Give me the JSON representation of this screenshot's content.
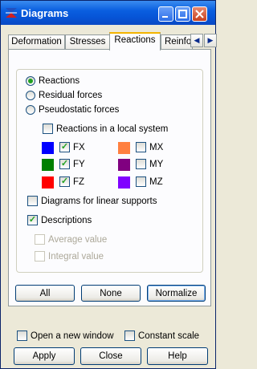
{
  "window": {
    "title": "Diagrams"
  },
  "tabs": [
    "Deformation",
    "Stresses",
    "Reactions",
    "Reinfo"
  ],
  "active_tab": "Reactions",
  "reaction_type": {
    "options": [
      "Reactions",
      "Residual forces",
      "Pseudostatic forces"
    ],
    "selected": "Reactions"
  },
  "local_system": {
    "label": "Reactions in a local system",
    "checked": false
  },
  "components": [
    {
      "label": "FX",
      "color": "#0000ff",
      "checked": true
    },
    {
      "label": "FY",
      "color": "#008000",
      "checked": true
    },
    {
      "label": "FZ",
      "color": "#ff0000",
      "checked": true
    },
    {
      "label": "MX",
      "color": "#ff8040",
      "checked": false
    },
    {
      "label": "MY",
      "color": "#800080",
      "checked": false
    },
    {
      "label": "MZ",
      "color": "#8000ff",
      "checked": false
    }
  ],
  "linear_supports": {
    "label": "Diagrams for linear supports",
    "checked": false
  },
  "descriptions": {
    "label": "Descriptions",
    "checked": true
  },
  "average_value": {
    "label": "Average value",
    "checked": false
  },
  "integral_value": {
    "label": "Integral value",
    "checked": false
  },
  "panel_buttons": {
    "all": "All",
    "none": "None",
    "normalize": "Normalize"
  },
  "open_new_window": {
    "label": "Open a new window",
    "checked": false
  },
  "constant_scale": {
    "label": "Constant scale",
    "checked": false
  },
  "footer_buttons": {
    "apply": "Apply",
    "close": "Close",
    "help": "Help"
  }
}
